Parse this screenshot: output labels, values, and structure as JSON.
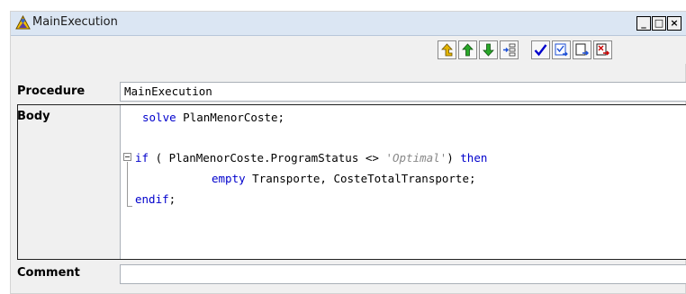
{
  "window": {
    "title": "MainExecution",
    "minimize_label": "_",
    "maximize_label": "□",
    "close_label": "×"
  },
  "toolbar": {
    "buttons": [
      {
        "icon": "move-to-parent-icon",
        "color": "#d6a800"
      },
      {
        "icon": "move-up-icon",
        "color": "#1f9d1f"
      },
      {
        "icon": "move-down-icon",
        "color": "#1f9d1f"
      },
      {
        "icon": "insert-node-icon",
        "color": "#333333"
      },
      {
        "icon": "check-icon",
        "color": "#0000cc"
      },
      {
        "icon": "compile-icon",
        "color": "#1c4fd6"
      },
      {
        "icon": "run-icon",
        "color": "#1c4fd6"
      },
      {
        "icon": "delete-icon",
        "color": "#cc0000"
      }
    ]
  },
  "attributes": {
    "procedure_label": "Procedure",
    "procedure_value": "MainExecution",
    "body_label": "Body",
    "comment_label": "Comment",
    "comment_value": ""
  },
  "code": {
    "line1_kw": "solve",
    "line1_rest": " PlanMenorCoste;",
    "line2_kw": "if",
    "line2_mid": " ( PlanMenorCoste.ProgramStatus <> ",
    "line2_q1": "'",
    "line2_str": "Optimal",
    "line2_q2": "'",
    "line2_close": ") ",
    "line2_kw2": "then",
    "line3_kw": "empty",
    "line3_rest": " Transporte, CosteTotalTransporte;",
    "line4_kw": "endif",
    "line4_rest": ";"
  },
  "colors": {
    "keyword": "#0000cc",
    "string": "#888888",
    "titlebar": "#dbe6f3"
  }
}
